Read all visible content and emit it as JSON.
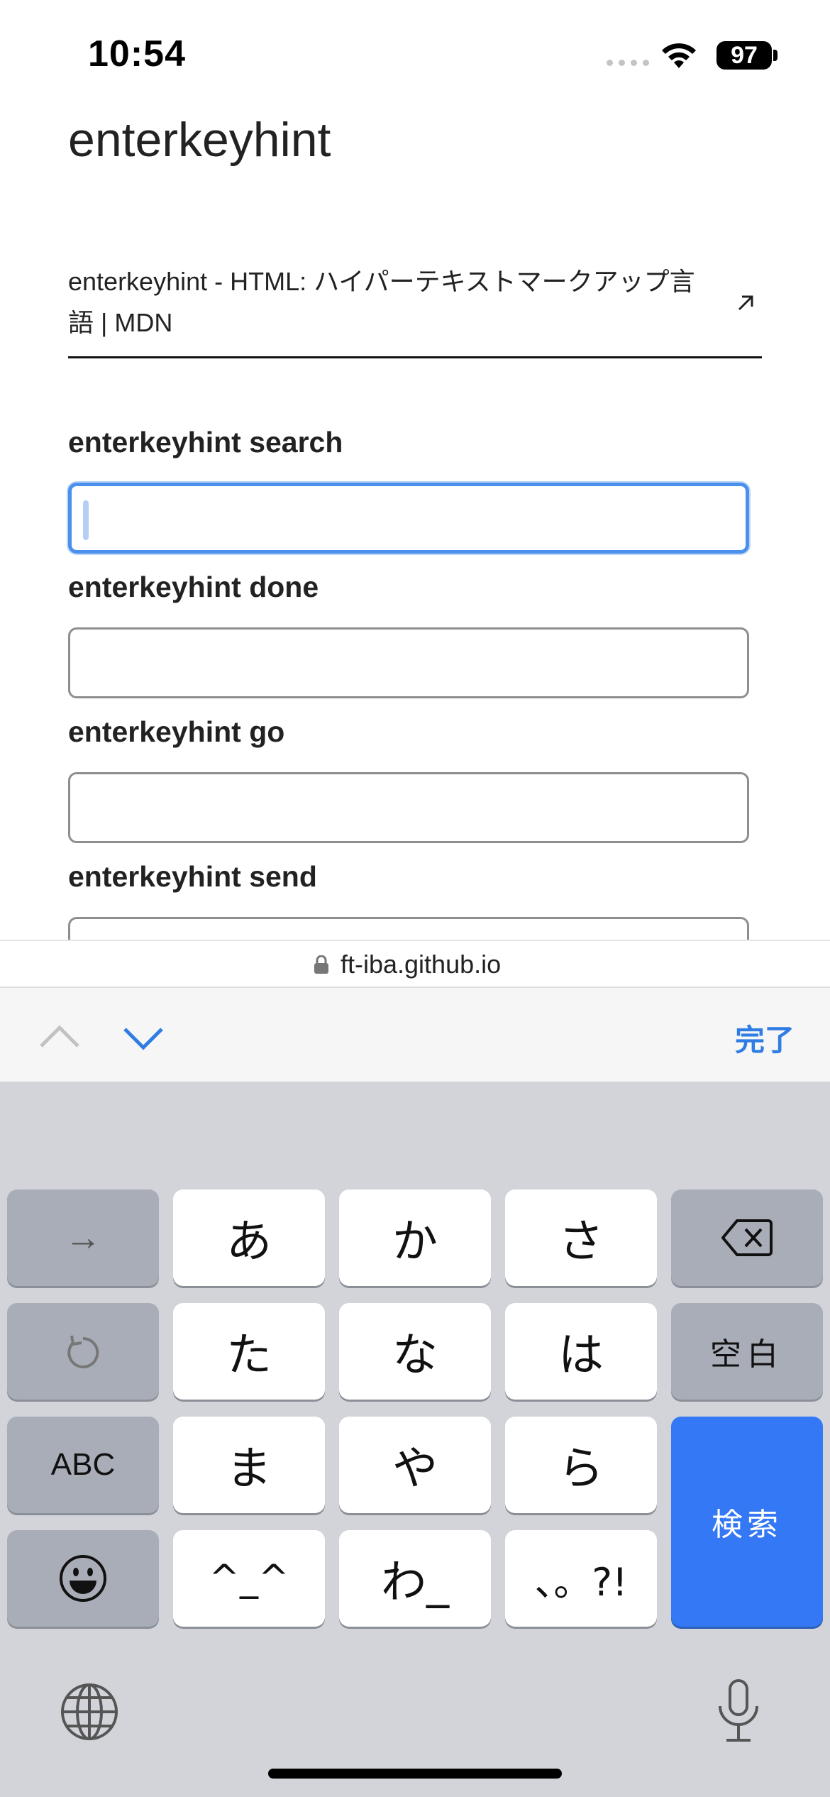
{
  "status_bar": {
    "time": "10:54",
    "battery": "97"
  },
  "page": {
    "title": "enterkeyhint",
    "link_text": "enterkeyhint - HTML: ハイパーテキストマークアップ言語 | MDN",
    "fields": [
      {
        "label": "enterkeyhint search"
      },
      {
        "label": "enterkeyhint done"
      },
      {
        "label": "enterkeyhint go"
      },
      {
        "label": "enterkeyhint send"
      }
    ]
  },
  "url_bar": {
    "domain": "ft-iba.github.io"
  },
  "accessory_bar": {
    "done_label": "完了"
  },
  "keyboard": {
    "row1": [
      "→",
      "あ",
      "か",
      "さ",
      "⌫"
    ],
    "row2": [
      "↺",
      "た",
      "な",
      "は",
      "空白"
    ],
    "row3": [
      "ABC",
      "ま",
      "や",
      "ら"
    ],
    "row4": [
      "😀",
      "^_^",
      "わ_",
      "、。?!"
    ],
    "action_key": "検索"
  },
  "colors": {
    "accent": "#2f7de4",
    "action_key": "#3478f6",
    "focus_ring": "#4a90ec",
    "keyboard_bg": "#d2d4da"
  }
}
